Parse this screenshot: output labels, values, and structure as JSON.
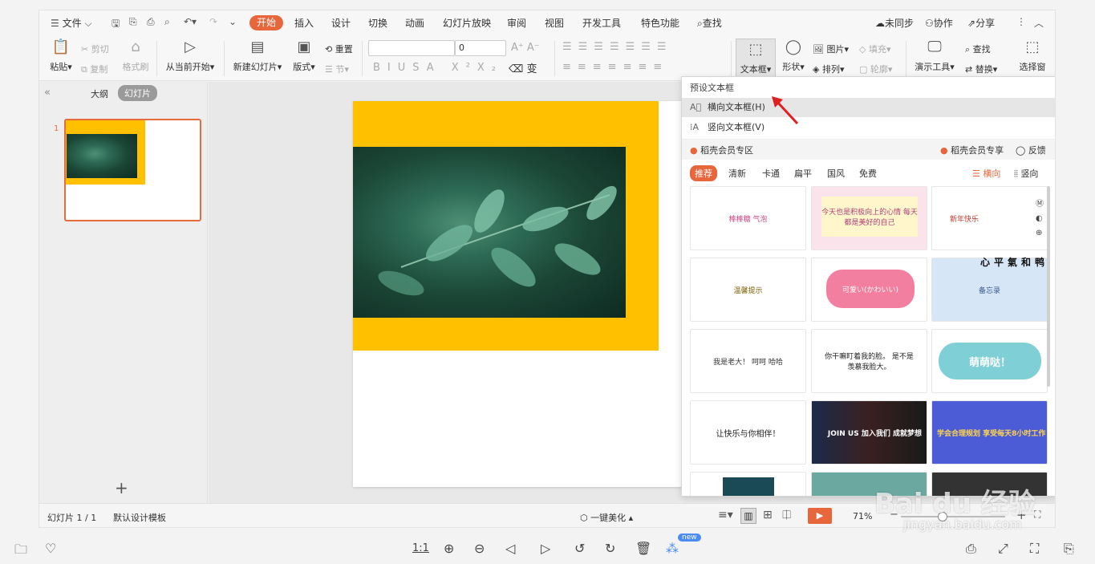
{
  "tabbar": {
    "file_menu": "文件",
    "tabs": [
      "开始",
      "插入",
      "设计",
      "切换",
      "动画",
      "幻灯片放映",
      "审阅",
      "视图",
      "开发工具",
      "特色功能"
    ],
    "search": "查找",
    "unsynced": "未同步",
    "collab": "协作",
    "share": "分享"
  },
  "ribbon": {
    "paste": "粘贴",
    "cut": "剪切",
    "copy": "复制",
    "format_painter": "格式刷",
    "from_current": "从当前开始",
    "new_slide": "新建幻灯片",
    "layout": "版式",
    "reset": "重置",
    "section": "节",
    "font_size": "0",
    "textbox": "文本框",
    "shape": "形状",
    "picture": "图片",
    "fill": "填充",
    "arrange": "排列",
    "outline": "轮廓",
    "presentation_tools": "演示工具",
    "find": "查找",
    "replace": "替换",
    "selection_pane": "选择窗"
  },
  "leftpanel": {
    "tab_outline": "大纲",
    "tab_slides": "幻灯片",
    "slide_number": "1",
    "add": "+"
  },
  "dropdown": {
    "header": "预设文本框",
    "horizontal": "横向文本框(H)",
    "vertical": "竖向文本框(V)",
    "member_zone": "稻壳会员专区",
    "member_share": "稻壳会员专享",
    "feedback": "反馈",
    "filters": [
      "推荐",
      "清新",
      "卡通",
      "扁平",
      "国风",
      "免费"
    ],
    "orient_horizontal": "横向",
    "orient_vertical": "竖向",
    "cards": [
      {
        "text": "棒棒糖 气泡"
      },
      {
        "text": "今天也是积极向上的心情 每天都是美好的自己"
      },
      {
        "text": "新年快乐"
      },
      {
        "text": "温馨提示"
      },
      {
        "text": "可爱い(かわいい)"
      },
      {
        "text": "备忘录"
      },
      {
        "text": "我是老大！ 呵呵 哈哈"
      },
      {
        "text": "你干嘛盯着我的脸。 是不是羡慕我脸大。"
      },
      {
        "text": "萌萌哒！"
      },
      {
        "text": "让快乐与你相伴！"
      },
      {
        "text": "JOIN US 加入我们 成就梦想"
      },
      {
        "text": "学会合理规划 享受每天8小时工作"
      }
    ],
    "side_text": "心平氣和鸭"
  },
  "statusbar": {
    "slide_info": "幻灯片 1 / 1",
    "template": "默认设计模板",
    "beautify": "一键美化",
    "zoom": "71%"
  },
  "bottombar": {
    "ratio": "1:1",
    "new_badge": "new"
  },
  "watermark": {
    "text": "Bai du 经验",
    "url": "jingyan.baidu.com"
  },
  "colors": {
    "accent": "#e8663c",
    "slide_yellow": "#ffc000",
    "arrow_red": "#e02020"
  }
}
